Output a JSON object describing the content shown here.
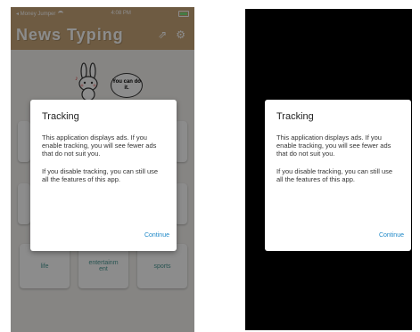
{
  "status_bar": {
    "back_app": "◂ Money Jumper",
    "time": "4:08 PM"
  },
  "app": {
    "title": "News Typing"
  },
  "mascot": {
    "speech": "You can do it."
  },
  "categories": [
    {
      "label": "life"
    },
    {
      "label": "entertainm ent"
    },
    {
      "label": "sports"
    }
  ],
  "dialog": {
    "title": "Tracking",
    "paragraph1": "This application displays ads. If you enable tracking, you will see fewer ads that do not suit you.",
    "paragraph2": "If you disable tracking, you can still use all the features of this app.",
    "continue_label": "Continue"
  },
  "colors": {
    "header": "#c9a679",
    "accent_text": "#4b9a96",
    "link": "#1e88c8"
  }
}
